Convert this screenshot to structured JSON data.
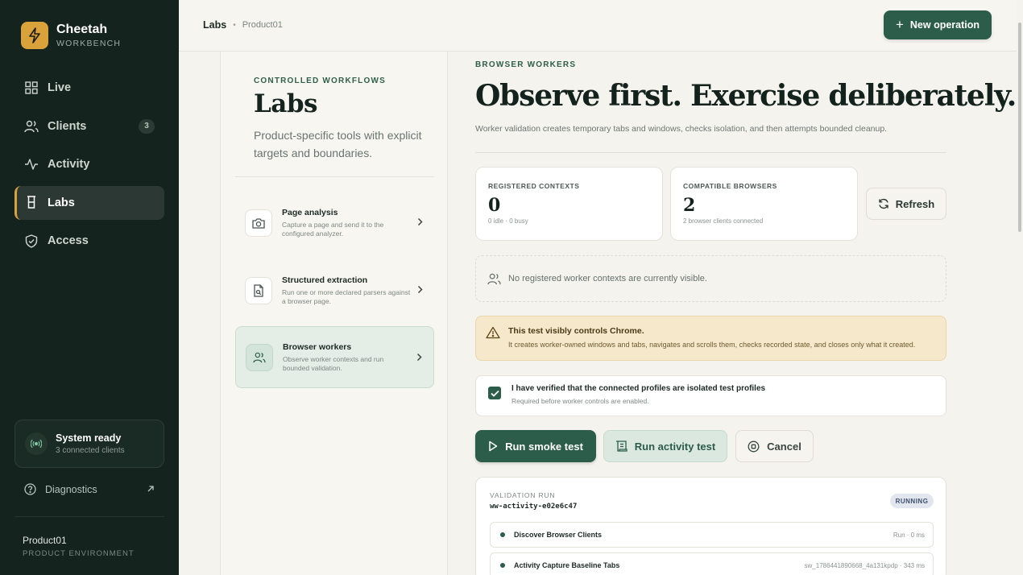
{
  "brand": {
    "name": "Cheetah",
    "subtitle": "WORKBENCH",
    "logo_icon": "lightning-icon",
    "logo_color": "#d9a23a"
  },
  "sidebar": {
    "items": [
      {
        "label": "Live",
        "icon": "grid-icon"
      },
      {
        "label": "Clients",
        "icon": "users-icon",
        "badge": "3"
      },
      {
        "label": "Activity",
        "icon": "activity-icon"
      },
      {
        "label": "Labs",
        "icon": "beaker-icon",
        "active": true
      },
      {
        "label": "Access",
        "icon": "shield-icon"
      }
    ],
    "status": {
      "title": "System ready",
      "subtitle": "3 connected clients"
    },
    "diagnostics": "Diagnostics",
    "environment": {
      "name": "Product01",
      "label": "PRODUCT ENVIRONMENT"
    }
  },
  "topbar": {
    "breadcrumb": {
      "main": "Labs",
      "separator": "•",
      "sub": "Product01"
    },
    "new_operation": "New operation"
  },
  "labs": {
    "eyebrow": "CONTROLLED WORKFLOWS",
    "title": "Labs",
    "description": "Product-specific tools with explicit targets and boundaries.",
    "tools": [
      {
        "title": "Page analysis",
        "description": "Capture a page and send it to the configured analyzer.",
        "icon": "camera-icon"
      },
      {
        "title": "Structured extraction",
        "description": "Run one or more declared parsers against a browser page.",
        "icon": "file-search-icon"
      },
      {
        "title": "Browser workers",
        "description": "Observe worker contexts and run bounded validation.",
        "icon": "users-icon",
        "active": true
      }
    ]
  },
  "main": {
    "eyebrow": "BROWSER WORKERS",
    "title": "Observe first. Exercise deliberately.",
    "description": "Worker validation creates temporary tabs and windows, checks isolation, and then attempts bounded cleanup.",
    "stats": [
      {
        "label": "REGISTERED CONTEXTS",
        "value": "0",
        "sub": "0 idle · 0 busy"
      },
      {
        "label": "COMPATIBLE BROWSERS",
        "value": "2",
        "sub": "2 browser clients connected"
      }
    ],
    "refresh": "Refresh",
    "empty_message": "No registered worker contexts are currently visible.",
    "warning": {
      "title": "This test visibly controls Chrome.",
      "text": "It creates worker-owned windows and tabs, navigates and scrolls them, checks recorded state, and closes only what it created."
    },
    "verify": {
      "checked": true,
      "title": "I have verified that the connected profiles are isolated test profiles",
      "subtitle": "Required before worker controls are enabled."
    },
    "actions": {
      "smoke": "Run smoke test",
      "activity": "Run activity test",
      "cancel": "Cancel"
    },
    "run": {
      "label": "VALIDATION RUN",
      "id": "ww-activity-e02e6c47",
      "status": "RUNNING",
      "steps": [
        {
          "name": "Discover Browser Clients",
          "meta": "Run · 0 ms"
        },
        {
          "name": "Activity Capture Baseline Tabs",
          "meta": "sw_1786441890668_4a131kpdp · 343 ms"
        }
      ]
    }
  },
  "colors": {
    "accent": "#2b5d4a",
    "sidebar_bg": "#14231e",
    "warning_bg": "#f6e8cb"
  }
}
